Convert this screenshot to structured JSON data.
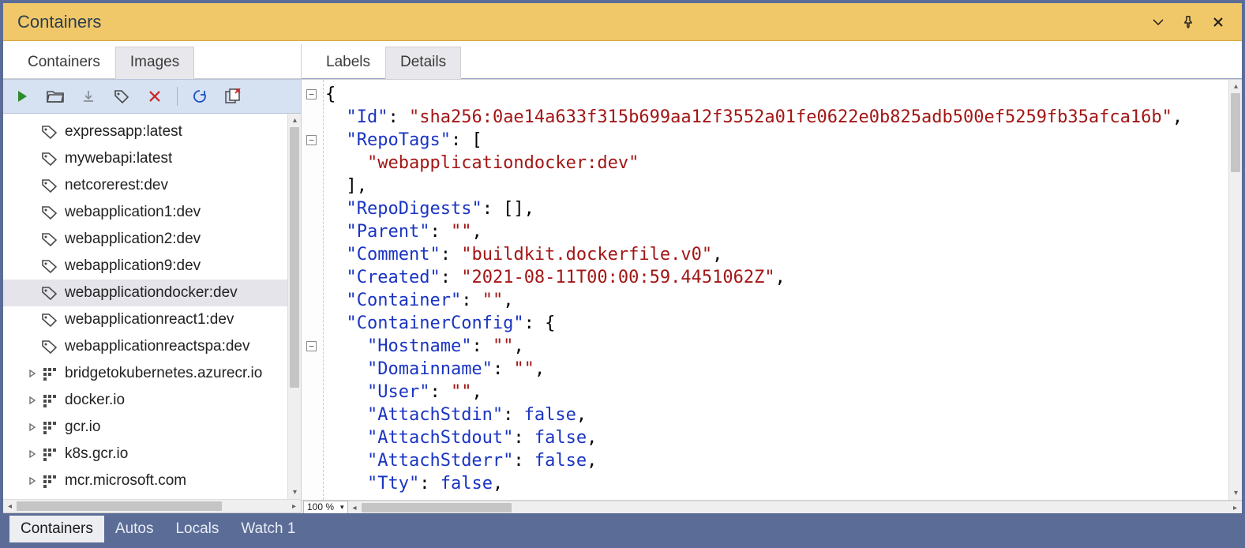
{
  "window": {
    "title": "Containers"
  },
  "left_tabs": {
    "items": [
      "Containers",
      "Images"
    ],
    "active_index": 1
  },
  "right_tabs": {
    "items": [
      "Labels",
      "Details"
    ],
    "active_index": 1
  },
  "tree": {
    "items": [
      {
        "kind": "image",
        "label": "expressapp:latest"
      },
      {
        "kind": "image",
        "label": "mywebapi:latest"
      },
      {
        "kind": "image",
        "label": "netcorerest:dev"
      },
      {
        "kind": "image",
        "label": "webapplication1:dev"
      },
      {
        "kind": "image",
        "label": "webapplication2:dev"
      },
      {
        "kind": "image",
        "label": "webapplication9:dev"
      },
      {
        "kind": "image",
        "label": "webapplicationdocker:dev",
        "selected": true
      },
      {
        "kind": "image",
        "label": "webapplicationreact1:dev"
      },
      {
        "kind": "image",
        "label": "webapplicationreactspa:dev",
        "truncated": true
      },
      {
        "kind": "registry",
        "label": "bridgetokubernetes.azurecr.io",
        "truncated": true,
        "expandable": true
      },
      {
        "kind": "registry",
        "label": "docker.io",
        "expandable": true
      },
      {
        "kind": "registry",
        "label": "gcr.io",
        "expandable": true
      },
      {
        "kind": "registry",
        "label": "k8s.gcr.io",
        "expandable": true
      },
      {
        "kind": "registry",
        "label": "mcr.microsoft.com",
        "expandable": true
      }
    ]
  },
  "editor": {
    "zoom": "100 %",
    "json": {
      "Id": "sha256:0ae14a633f315b699aa12f3552a01fe0622e0b825adb500ef5259fb35afca16b",
      "RepoTags": [
        "webapplicationdocker:dev"
      ],
      "RepoDigests": [],
      "Parent": "",
      "Comment": "buildkit.dockerfile.v0",
      "Created": "2021-08-11T00:00:59.4451062Z",
      "Container": "",
      "ContainerConfig": {
        "Hostname": "",
        "Domainname": "",
        "User": "",
        "AttachStdin": false,
        "AttachStdout": false,
        "AttachStderr": false,
        "Tty": false
      }
    },
    "fold_lines": [
      0,
      2,
      11
    ]
  },
  "bottom_tabs": {
    "items": [
      "Containers",
      "Autos",
      "Locals",
      "Watch 1"
    ],
    "active_index": 0
  }
}
